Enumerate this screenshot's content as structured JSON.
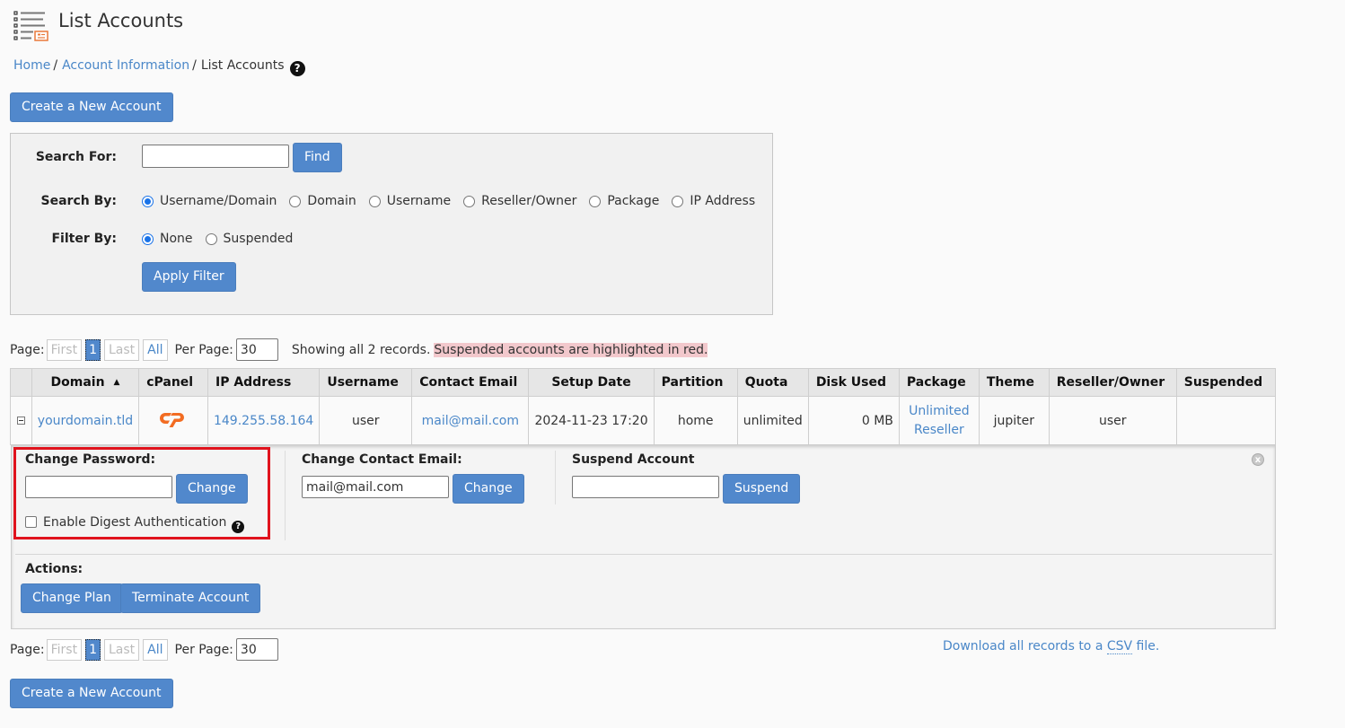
{
  "header": {
    "title": "List Accounts",
    "icon": "list-accounts-icon"
  },
  "breadcrumb": {
    "items": [
      "Home",
      "Account Information"
    ],
    "current": "List Accounts",
    "separator": "/",
    "help_glyph": "?"
  },
  "actions": {
    "create_account_label": "Create a New Account"
  },
  "search": {
    "search_for_label": "Search For:",
    "search_value": "",
    "find_label": "Find",
    "search_by_label": "Search By:",
    "search_by_options": [
      "Username/Domain",
      "Domain",
      "Username",
      "Reseller/Owner",
      "Package",
      "IP Address"
    ],
    "search_by_selected": "Username/Domain",
    "filter_by_label": "Filter By:",
    "filter_by_options": [
      "None",
      "Suspended"
    ],
    "filter_by_selected": "None",
    "apply_filter_label": "Apply Filter"
  },
  "pagination": {
    "page_label": "Page:",
    "first_label": "First",
    "current_page": "1",
    "last_label": "Last",
    "all_label": "All",
    "per_page_label": "Per Page:",
    "per_page_value": "30",
    "showing_text": "Showing all 2 records.",
    "suspended_note": "Suspended accounts are highlighted in red."
  },
  "table": {
    "columns": [
      "",
      "Domain",
      "cPanel",
      "IP Address",
      "Username",
      "Contact Email",
      "Setup Date",
      "Partition",
      "Quota",
      "Disk Used",
      "Package",
      "Theme",
      "Reseller/Owner",
      "Suspended"
    ],
    "sort_column": "Domain",
    "sort_glyph": "▲",
    "rows": [
      {
        "domain": "yourdomain.tld",
        "cpanel_icon": "cpanel-logo-icon",
        "ip_address": "149.255.58.164",
        "username": "user",
        "contact_email": "mail@mail.com",
        "setup_date": "2024-11-23 17:20",
        "partition": "home",
        "quota": "unlimited",
        "disk_used": "0 MB",
        "package_line1": "Unlimited",
        "package_line2": "Reseller",
        "theme": "jupiter",
        "reseller_owner": "user",
        "suspended": ""
      }
    ]
  },
  "details": {
    "change_password_title": "Change Password:",
    "password_value": "",
    "change_label": "Change",
    "digest_auth_label": "Enable Digest Authentication",
    "digest_auth_checked": false,
    "change_email_title": "Change Contact Email:",
    "email_value": "mail@mail.com",
    "suspend_title": "Suspend Account",
    "suspend_reason_value": "",
    "suspend_label": "Suspend",
    "actions_title": "Actions:",
    "change_plan_label": "Change Plan",
    "terminate_label": "Terminate Account",
    "close_glyph": "x"
  },
  "footer": {
    "download_prefix": "Download all records to a ",
    "download_abbr": "CSV",
    "download_suffix": " file."
  },
  "colors": {
    "primary_button": "#5188cc",
    "link": "#4a87c8",
    "highlight_border": "#e0131d",
    "suspended_note_bg": "#f2c8cc",
    "cpanel_orange": "#f26c22"
  }
}
